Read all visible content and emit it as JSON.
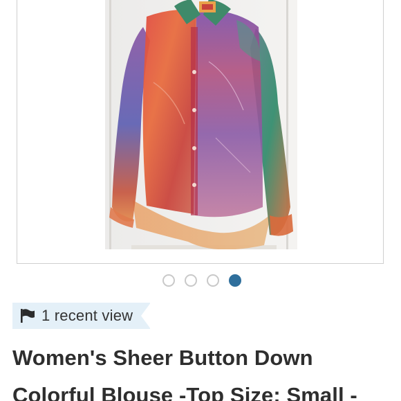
{
  "carousel": {
    "image_alt": "Colorful sheer tie-dye button down blouse hanging on a door",
    "dots": [
      {
        "active": false
      },
      {
        "active": false
      },
      {
        "active": false
      },
      {
        "active": true
      }
    ],
    "active_index": 3,
    "total": 4
  },
  "views": {
    "icon": "flag-icon",
    "text": "1 recent view"
  },
  "listing": {
    "title_line1": "Women's Sheer Button Down",
    "title_line2": "Colorful Blouse -Top Size: Small -"
  },
  "colors": {
    "accent": "#2f6f9c",
    "badge_bg": "#e4f0f8",
    "title_text": "#2e2e2e"
  }
}
